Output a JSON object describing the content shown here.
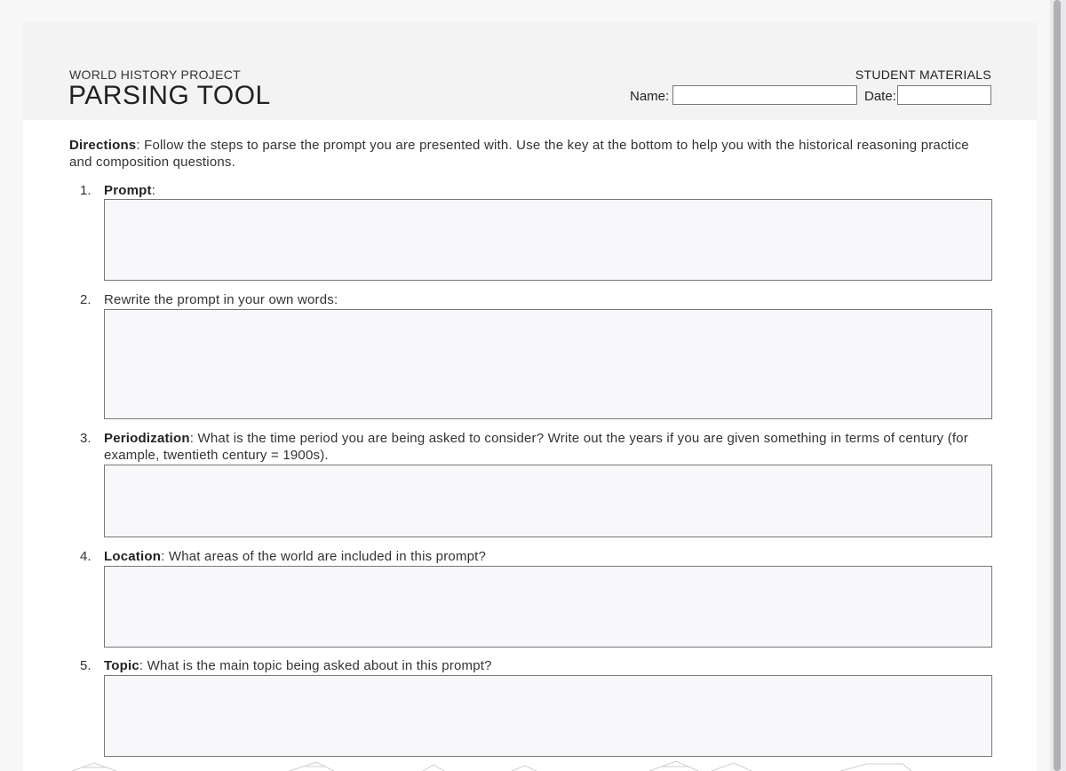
{
  "header": {
    "project": "WORLD HISTORY PROJECT",
    "title": "PARSING TOOL",
    "materials": "STUDENT MATERIALS",
    "name_label": "Name:",
    "name_value": "",
    "date_label": "Date:",
    "date_value": ""
  },
  "directions": {
    "label": "Directions",
    "text": ": Follow the steps to parse the prompt you are presented with. Use the key at the bottom to help you with the historical reasoning practice and composition questions."
  },
  "questions": [
    {
      "number": "1.",
      "label": "Prompt",
      "text": ":",
      "answer": ""
    },
    {
      "number": "2.",
      "label": "",
      "text": "Rewrite the prompt in your own words:",
      "answer": ""
    },
    {
      "number": "3.",
      "label": "Periodization",
      "text": ": What is the time period you are being asked to consider? Write out the years if you are given something in terms of century (for example, twentieth century = 1900s).",
      "answer": ""
    },
    {
      "number": "4.",
      "label": "Location",
      "text": ": What areas of the world are included in this prompt?",
      "answer": ""
    },
    {
      "number": "5.",
      "label": "Topic",
      "text": ": What is the main topic being asked about in this prompt?",
      "answer": ""
    }
  ]
}
